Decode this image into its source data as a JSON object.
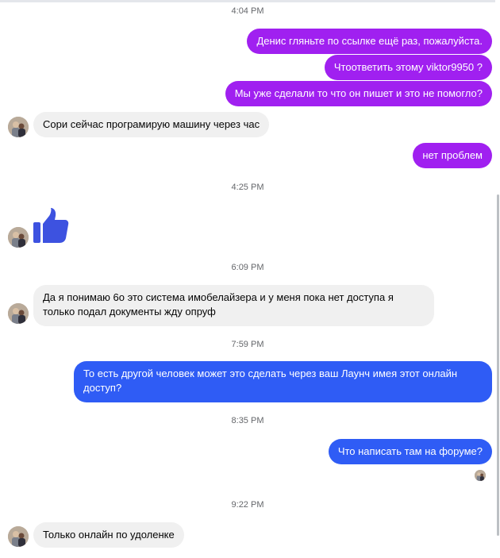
{
  "conversation": {
    "timestamps": [
      "4:04 PM",
      "4:25 PM",
      "6:09 PM",
      "7:59 PM",
      "8:35 PM",
      "9:22 PM"
    ],
    "messages": [
      {
        "text": "Денис гляньте по ссылке ещё раз, пожалуйста.",
        "direction": "outgoing"
      },
      {
        "text": "Чтоответить этому viktor9950 ?",
        "direction": "outgoing"
      },
      {
        "text": "Мы уже сделали то что он пишет и это не помогло?",
        "direction": "outgoing"
      },
      {
        "text": "Сори сейчас програмирую машину через час",
        "direction": "incoming"
      },
      {
        "text": "нет проблем",
        "direction": "outgoing"
      },
      {
        "text": "Да я понимаю  6о это система имобелайзера и у меня пока нет доступа я только подал документы жду опруф",
        "direction": "incoming"
      },
      {
        "text": "То есть другой человек может это сделать через ваш Лаунч имея этот онлайн доступ?",
        "direction": "outgoing"
      },
      {
        "text": "Что написать там на форуме?",
        "direction": "outgoing"
      },
      {
        "text": "Только  онлайн  по удоленке",
        "direction": "incoming"
      }
    ],
    "reaction_sticker": "thumbs-up-icon"
  },
  "colors": {
    "outgoing_purple": "#a020f0",
    "outgoing_blue": "#2f5cf5",
    "incoming": "#f0f0f0",
    "like": "#3d52e0"
  }
}
